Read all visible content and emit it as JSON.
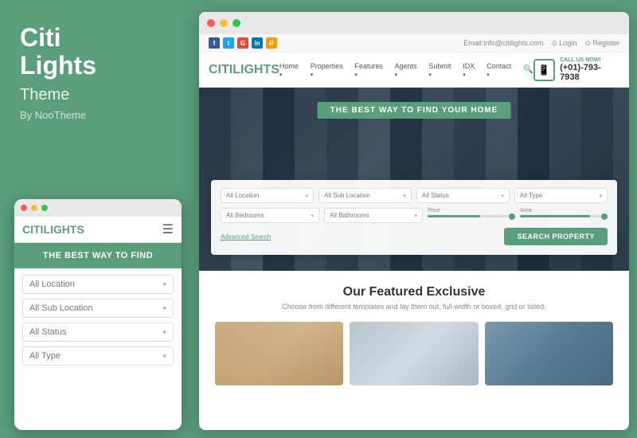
{
  "brand": {
    "title": "Citi\nLights",
    "subtitle": "Theme",
    "by": "By NooTheme",
    "logo_citi": "CITI",
    "logo_lights": "LIGHTS"
  },
  "browser": {
    "dots": [
      "#fc5c55",
      "#fdbc40",
      "#34c84a"
    ]
  },
  "topbar": {
    "email": "Email:info@citilights.com",
    "login": "Login",
    "register": "Register",
    "social": [
      "f",
      "t",
      "G+",
      "in",
      "RSS"
    ]
  },
  "navbar": {
    "logo_citi": "CITI",
    "logo_lights": "LIGHTS",
    "links": [
      "Home",
      "Properties",
      "Features",
      "Agents",
      "Submit",
      "IDX",
      "Contact"
    ],
    "phone_label": "CALL US NOW!",
    "phone_number": "(+01)-793-7938"
  },
  "hero": {
    "tagline": "THE BEST WAY TO FIND YOUR HOME",
    "search_form": {
      "row1": [
        "All Location",
        "All Sub Location",
        "All Status",
        "All Type"
      ],
      "row2": [
        "All Bedrooms",
        "All Bathrooms"
      ],
      "price_label": "Price",
      "area_label": "Area",
      "advanced_link": "Advanced Search",
      "search_btn": "Search Property"
    }
  },
  "featured": {
    "title": "Our Featured Exclusive",
    "description": "Choose from different templates and lay them out, full-width or boxed, grid or listed."
  },
  "mobile": {
    "logo_citi": "CITI",
    "logo_lights": "LIGHTS",
    "tagline": "THE BEST WAY TO FIND",
    "selects": [
      "All Location",
      "All Sub Location",
      "All Status",
      "All Type"
    ],
    "dots": [
      "#fc5c55",
      "#fdbc40",
      "#34c84a"
    ]
  },
  "colors": {
    "green": "#5a9e7c",
    "dark": "#333333",
    "light_gray": "#f8f8f8"
  }
}
